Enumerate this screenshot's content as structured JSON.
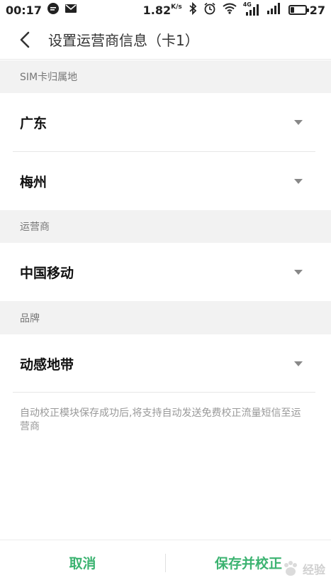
{
  "status_bar": {
    "time": "00:17",
    "speed_value": "1.82",
    "speed_unit": "K/s",
    "network_label": "4G",
    "battery_level": "27",
    "battery_fraction": 0.27
  },
  "header": {
    "title": "设置运营商信息（卡1）"
  },
  "sections": {
    "sim_location_label": "SIM卡归属地",
    "carrier_label": "运营商",
    "brand_label": "品牌"
  },
  "fields": {
    "province": "广东",
    "city": "梅州",
    "carrier": "中国移动",
    "brand": "动感地带"
  },
  "note": "自动校正模块保存成功后,将支持自动发送免费校正流量短信至运营商",
  "footer": {
    "cancel_label": "取消",
    "save_label": "保存并校正"
  },
  "watermark": {
    "text": "经验"
  },
  "colors": {
    "accent": "#3cb371",
    "section_bg": "#f2f2f2"
  }
}
